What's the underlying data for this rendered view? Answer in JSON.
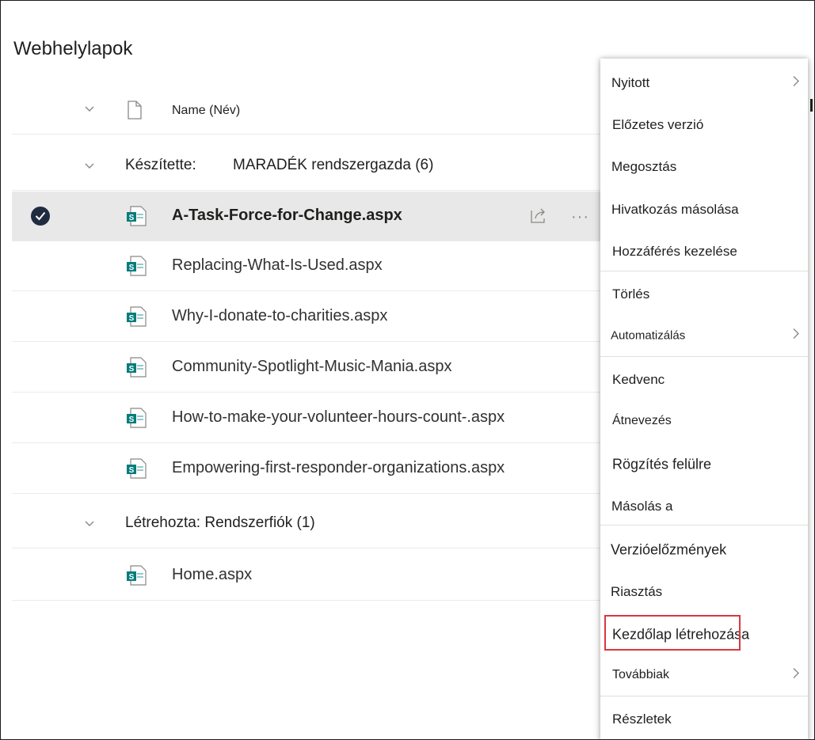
{
  "page": {
    "title": "Webhelylapok"
  },
  "list": {
    "header": {
      "name_label": "Name (Név)"
    },
    "groups": [
      {
        "label_prefix": "Készítette:",
        "label_value": "MARADÉK rendszergazda (6)",
        "files": [
          {
            "name": "A-Task-Force-for-Change.aspx",
            "selected": true
          },
          {
            "name": "Replacing-What-Is-Used.aspx",
            "selected": false
          },
          {
            "name": "Why-I-donate-to-charities.aspx",
            "selected": false
          },
          {
            "name": "Community-Spotlight-Music-Mania.aspx",
            "selected": false
          },
          {
            "name": "How-to-make-your-volunteer-hours-count-.aspx",
            "selected": false
          },
          {
            "name": "Empowering-first-responder-organizations.aspx",
            "selected": false
          }
        ]
      },
      {
        "label": "Létrehozta: Rendszerfiók (1)",
        "files": [
          {
            "name": "Home.aspx",
            "selected": false
          }
        ]
      }
    ]
  },
  "context_menu": {
    "items": [
      {
        "label": "Nyitott",
        "submenu": true
      },
      {
        "label": "Előzetes verzió",
        "submenu": false
      },
      {
        "label": "Megosztás",
        "submenu": false
      },
      {
        "label": "Hivatkozás másolása",
        "submenu": false
      },
      {
        "label": "Hozzáférés kezelése",
        "submenu": false
      },
      {
        "label": "Törlés",
        "submenu": false
      },
      {
        "label": "Automatizálás",
        "submenu": true
      },
      {
        "label": "Kedvenc",
        "submenu": false
      },
      {
        "label": "Átnevezés",
        "submenu": false
      },
      {
        "label": "Rögzítés felülre",
        "submenu": false
      },
      {
        "label": "Másolás a",
        "submenu": false
      },
      {
        "label": "Verzióelőzmények",
        "submenu": false
      },
      {
        "label": "Riasztás",
        "submenu": false
      },
      {
        "label": "Kezdőlap létrehozása",
        "submenu": false,
        "highlighted": true
      },
      {
        "label": "Továbbiak",
        "submenu": true
      },
      {
        "label": "Részletek",
        "submenu": false
      }
    ]
  },
  "colors": {
    "highlight_border": "#d9383d",
    "selected_row": "#e8e8e8",
    "sharepoint_teal": "#037c7c",
    "check_circle": "#1f2c40"
  },
  "icons": {
    "file_type": "sharepoint-page-icon",
    "header_file": "document-icon",
    "share": "share-icon",
    "more": "more-icon",
    "chevron": "chevron-down-icon",
    "submenu": "chevron-right-icon"
  }
}
